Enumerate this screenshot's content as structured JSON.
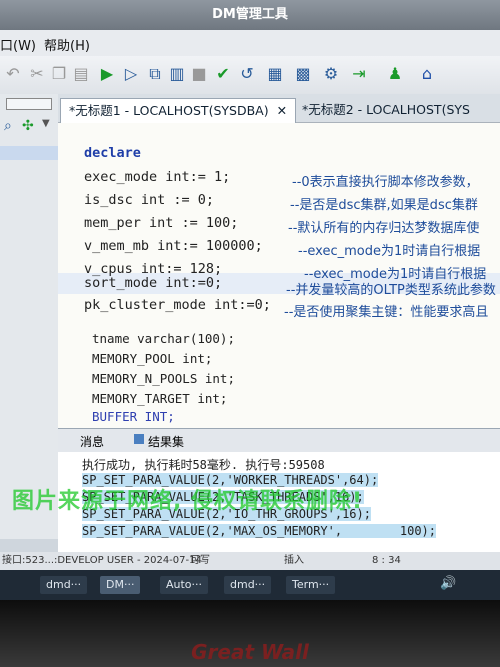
{
  "window": {
    "title": "DM管理工具"
  },
  "menu": {
    "window_fragment": "口(W)",
    "help": "帮助(H)"
  },
  "tabs": [
    {
      "label": "*无标题1 - LOCALHOST(SYSDBA)"
    },
    {
      "label": "*无标题2 - LOCALHOST(SYS"
    }
  ],
  "editor": {
    "lines": [
      {
        "code": "declare"
      },
      {
        "code": "exec_mode int:= 1;",
        "comment": "--0表示直接执行脚本修改参数，"
      },
      {
        "code": "is_dsc int := 0;",
        "comment": "--是否是dsc集群,如果是dsc集群"
      },
      {
        "code": "mem_per int := 100;",
        "comment": "--默认所有的内存归达梦数据库使"
      },
      {
        "code": "v_mem_mb int:= 100000;",
        "comment": "--exec_mode为1时请自行根据"
      },
      {
        "code": "v_cpus int:= 128;",
        "comment": "--exec_mode为1时请自行根据"
      },
      {
        "code": "sort_mode int:=0;",
        "comment": "--并发量较高的OLTP类型系统此参数"
      },
      {
        "code": "pk_cluster_mode int:=0;",
        "comment": "--是否使用聚集主键：性能要求高且"
      },
      {
        "code": ""
      },
      {
        "code": "tname varchar(100);"
      },
      {
        "code": "MEMORY_POOL int;"
      },
      {
        "code": "MEMORY_N_POOLS int;"
      },
      {
        "code": "MEMORY_TARGET int;"
      },
      {
        "code": "BUFFER INT;"
      }
    ]
  },
  "result_tabs": {
    "messages": "消息",
    "results": "结果集"
  },
  "results": {
    "lines": [
      "执行成功, 执行耗时58毫秒. 执行号:59508",
      "SP_SET_PARA_VALUE(2,'WORKER_THREADS',64);",
      "SP_SET_PARA_VALUE(2,'TASK_THREADS',16);",
      "SP_SET_PARA_VALUE(2,'IO_THR_GROUPS',16);",
      "SP_SET_PARA_VALUE(2,'MAX_OS_MEMORY',        100);"
    ]
  },
  "watermark": "图片来源于网络, 侵权请联系删除!",
  "status": {
    "connection": "接口:523...:DEVELOP USER - 2024-07-14",
    "mode": "可写",
    "insert": "插入",
    "position": "8 : 34"
  },
  "taskbar": {
    "items": [
      "dmd···",
      "DM···",
      "Auto···",
      "dmd···",
      "Term···"
    ]
  },
  "brand": "Great Wall",
  "colors": {
    "keyword": "#1f3ea8",
    "comment": "#1e4c9a",
    "watermark": "#1ec828"
  }
}
